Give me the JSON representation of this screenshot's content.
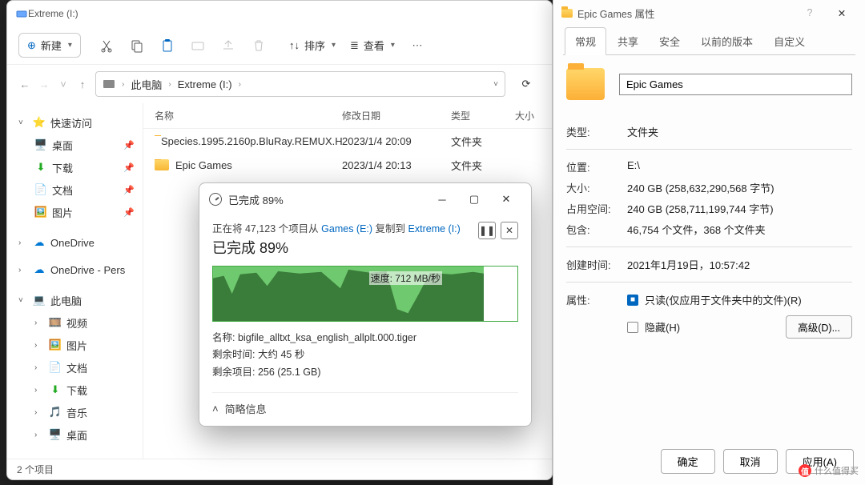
{
  "explorer": {
    "window_title": "Extreme (I:)",
    "toolbar": {
      "new": "新建",
      "sort": "排序",
      "view": "查看"
    },
    "breadcrumb": {
      "root": "此电脑",
      "drive": "Extreme (I:)"
    },
    "columns": {
      "name": "名称",
      "date": "修改日期",
      "type": "类型",
      "size": "大小"
    },
    "files": [
      {
        "name": "Species.1995.2160p.BluRay.REMUX.H...",
        "date": "2023/1/4 20:09",
        "type": "文件夹"
      },
      {
        "name": "Epic Games",
        "date": "2023/1/4 20:13",
        "type": "文件夹"
      }
    ],
    "status": "2 个项目",
    "sidebar": {
      "quick": "快速访问",
      "desktop": "桌面",
      "downloads": "下载",
      "documents": "文档",
      "pictures": "图片",
      "onedrive": "OneDrive",
      "onedrive_personal": "OneDrive - Pers",
      "thispc": "此电脑",
      "videos": "视频",
      "pictures2": "图片",
      "documents2": "文档",
      "downloads2": "下载",
      "music": "音乐",
      "desktop2": "桌面"
    }
  },
  "copy": {
    "title": "已完成 89%",
    "line1_prefix": "正在将 47,123 个项目从 ",
    "src": "Games (E:)",
    "mid": " 复制到 ",
    "dst": "Extreme (I:)",
    "percent": "已完成 89%",
    "speed_label": "速度: 712 MB/秒",
    "detail_name_label": "名称:",
    "detail_name": "bigfile_alltxt_ksa_english_allplt.000.tiger",
    "remaining_time_label": "剩余时间:",
    "remaining_time": "大约 45 秒",
    "remaining_items_label": "剩余项目:",
    "remaining_items": "256 (25.1 GB)",
    "more": "简略信息"
  },
  "props": {
    "title": "Epic Games 属性",
    "tabs": {
      "general": "常规",
      "share": "共享",
      "security": "安全",
      "prev": "以前的版本",
      "custom": "自定义"
    },
    "name": "Epic Games",
    "type_k": "类型:",
    "type_v": "文件夹",
    "loc_k": "位置:",
    "loc_v": "E:\\",
    "size_k": "大小:",
    "size_v": "240 GB (258,632,290,568 字节)",
    "ondisk_k": "占用空间:",
    "ondisk_v": "240 GB (258,711,199,744 字节)",
    "contains_k": "包含:",
    "contains_v": "46,754 个文件，368 个文件夹",
    "created_k": "创建时间:",
    "created_v": "2021年1月19日，10:57:42",
    "attr_k": "属性:",
    "readonly": "只读(仅应用于文件夹中的文件)(R)",
    "hidden": "隐藏(H)",
    "advanced": "高级(D)...",
    "ok": "确定",
    "cancel": "取消",
    "apply": "应用(A)"
  },
  "watermark": "什么值得买"
}
